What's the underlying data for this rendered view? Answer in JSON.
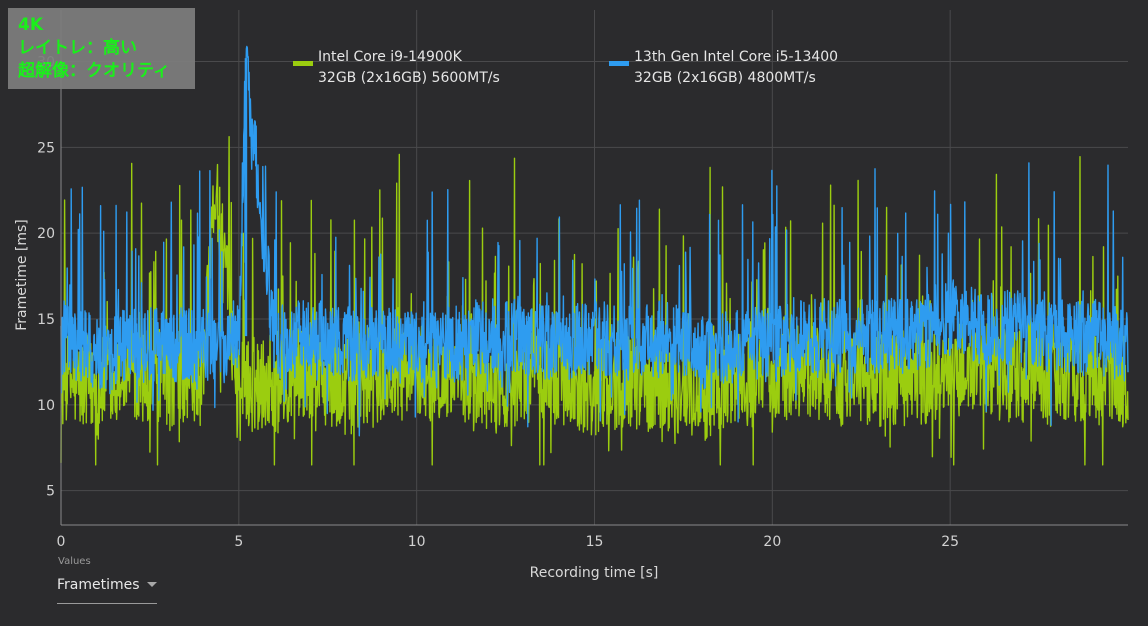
{
  "overlay": {
    "line1": "4K",
    "line2": "レイトレ：高い",
    "line3": "超解像：クオリティ"
  },
  "values_control": {
    "caption": "Values",
    "selected": "Frametimes"
  },
  "chart_data": {
    "type": "line",
    "xlabel": "Recording time [s]",
    "ylabel": "Frametime [ms]",
    "xlim": [
      0,
      30
    ],
    "ylim": [
      3,
      33
    ],
    "xticks": [
      0,
      5,
      10,
      15,
      20,
      25
    ],
    "yticks": [
      5,
      10,
      15,
      20,
      25,
      30
    ],
    "grid": true,
    "legend_position": "top",
    "series": [
      {
        "name": "Intel Core i9-14900K",
        "name_line2": "32GB (2x16GB) 5600MT/s",
        "color": "#9bcd0f",
        "typical_min": 7.5,
        "typical_max": 23,
        "mean_approx": 11.5,
        "x": [
          0,
          1,
          2,
          3,
          4,
          4.3,
          5,
          6,
          7,
          8,
          9,
          10,
          11,
          12,
          13,
          14,
          15,
          16,
          17,
          18,
          19,
          20,
          21,
          22,
          23,
          24,
          25,
          26,
          27,
          28,
          29,
          30
        ],
        "y": [
          11.5,
          11,
          12,
          11.5,
          11.5,
          23,
          11,
          11.5,
          12,
          11,
          11.5,
          12,
          11.5,
          11,
          11.5,
          11.5,
          11,
          11.5,
          11,
          10.5,
          11.5,
          11.5,
          12,
          11.5,
          11.5,
          11.5,
          12,
          12,
          11.5,
          12,
          11.5,
          11.5
        ]
      },
      {
        "name": "13th Gen Intel Core i5-13400",
        "name_line2": "32GB (2x16GB) 4800MT/s",
        "color": "#2e9cf0",
        "typical_min": 10,
        "typical_max": 23,
        "mean_approx": 13.5,
        "peak": {
          "x": 5.2,
          "y": 30.2
        },
        "x": [
          0,
          1,
          2,
          3,
          4,
          5,
          5.2,
          6,
          7,
          8,
          9,
          10,
          11,
          12,
          13,
          14,
          15,
          16,
          17,
          18,
          19,
          20,
          21,
          22,
          23,
          24,
          25,
          26,
          27,
          28,
          29,
          30
        ],
        "y": [
          14,
          13,
          13.5,
          13.5,
          13.5,
          14,
          30.2,
          13.5,
          14,
          13.5,
          13.5,
          13.5,
          13.5,
          14,
          14,
          13.5,
          14,
          13.5,
          14,
          13,
          13.5,
          13.5,
          14,
          14,
          14,
          14,
          15,
          14.5,
          14.5,
          14,
          14,
          13.5
        ]
      }
    ]
  }
}
